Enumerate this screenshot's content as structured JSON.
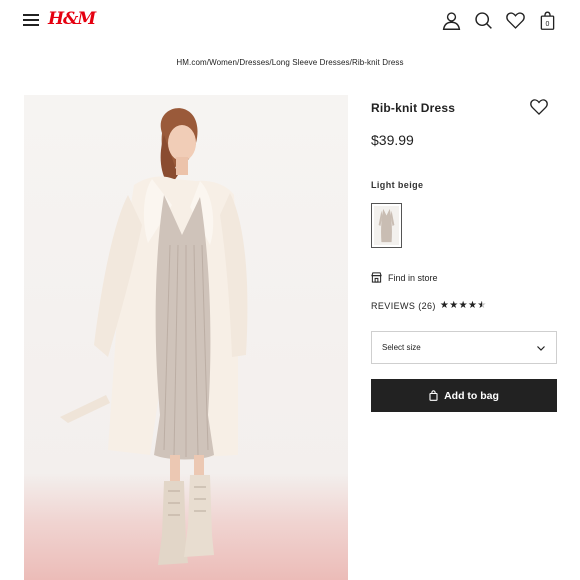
{
  "header": {
    "logo": "H&M",
    "icons": [
      "menu-icon",
      "account-icon",
      "search-icon",
      "favorites-icon",
      "bag-icon"
    ],
    "bag_count": "0"
  },
  "breadcrumb": "HM.com/Women/Dresses/Long Sleeve Dresses/Rib-knit Dress",
  "product": {
    "title": "Rib-knit Dress",
    "price": "$39.99",
    "color_name": "Light beige",
    "find_in_store": "Find in store",
    "reviews_label": "REVIEWS (26)",
    "rating": 4.5,
    "rating_max": 5,
    "size_placeholder": "Select size",
    "add_to_bag": "Add to bag"
  },
  "colors": {
    "brand_red": "#e50010",
    "button_dark": "#222222"
  }
}
